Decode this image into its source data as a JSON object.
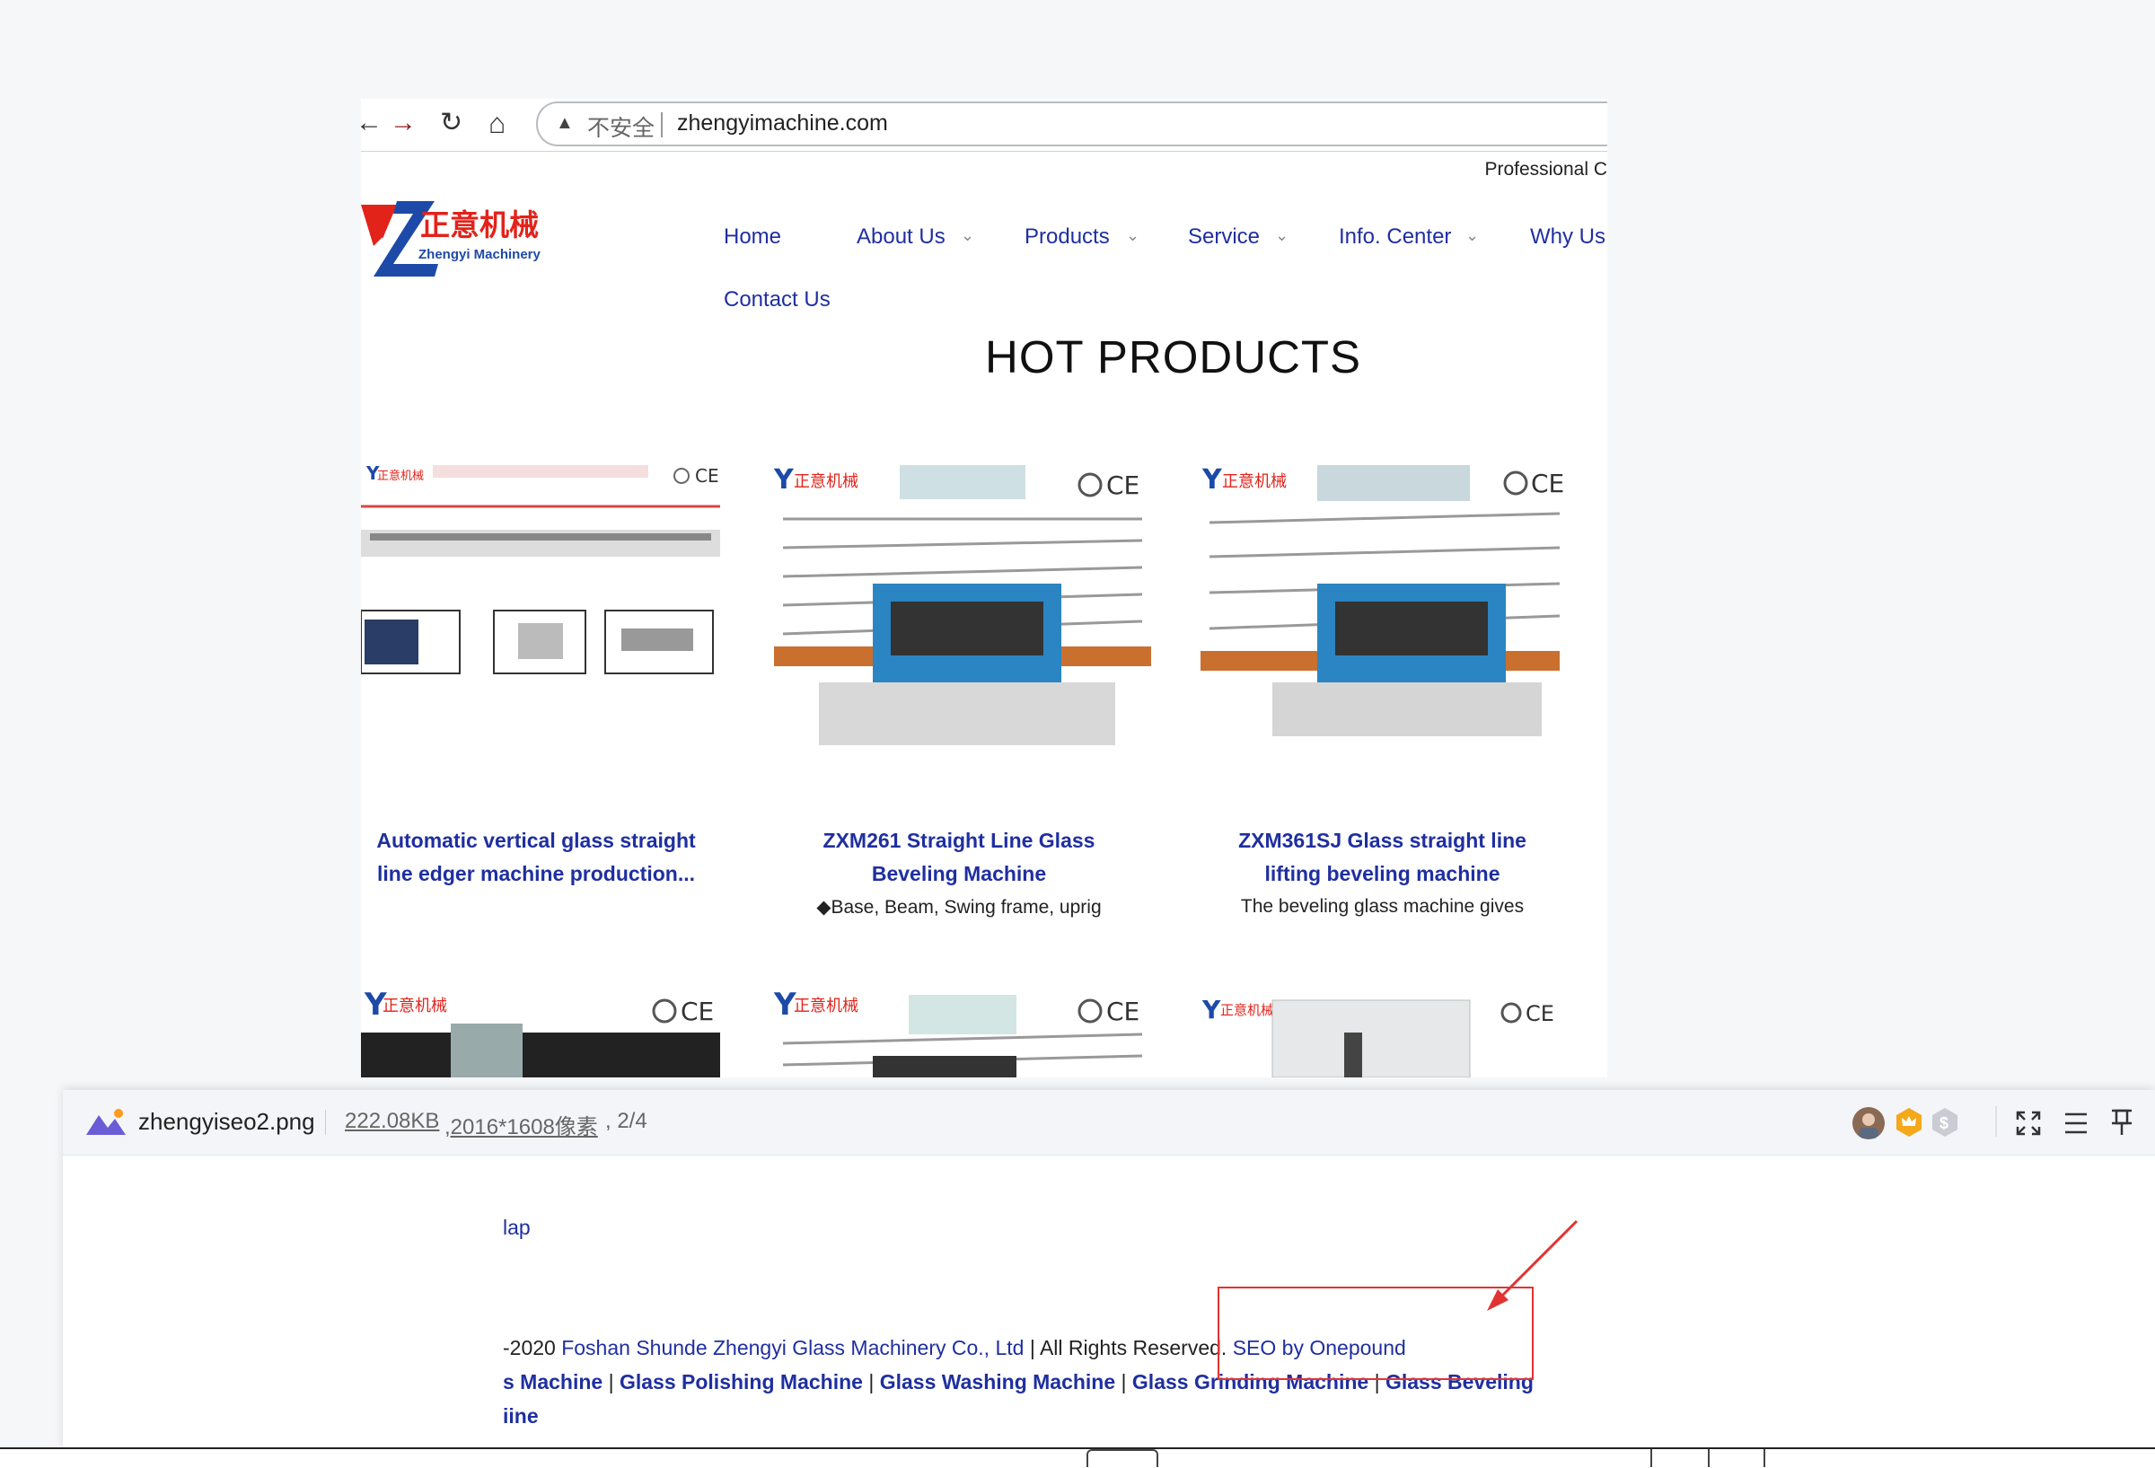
{
  "browser": {
    "back_label": "←",
    "forward_label": "→",
    "reload_label": "↻",
    "home_label": "⌂",
    "security_warning_icon": "warning-triangle-icon",
    "not_secure_label": "不安全",
    "url": "zhengyimachine.com"
  },
  "site": {
    "tagline": "Professional C",
    "logo_text_cn": "正意机械",
    "logo_text_en": "Zhengyi Machinery",
    "nav": [
      {
        "label": "Home",
        "has_dropdown": false
      },
      {
        "label": "About Us",
        "has_dropdown": true
      },
      {
        "label": "Products",
        "has_dropdown": true
      },
      {
        "label": "Service",
        "has_dropdown": true
      },
      {
        "label": "Info. Center",
        "has_dropdown": true
      },
      {
        "label": "Why Us",
        "has_dropdown": false
      },
      {
        "label": "Contact Us",
        "has_dropdown": false
      }
    ],
    "hot_products_title": "HOT PRODUCTS",
    "products": [
      {
        "title_l1": "Automatic vertical glass straight",
        "title_l2": "line edger machine production...",
        "desc": ""
      },
      {
        "title_l1": "ZXM261 Straight Line Glass",
        "title_l2": "Beveling Machine",
        "desc": "◆Base, Beam, Swing frame, uprig"
      },
      {
        "title_l1": "ZXM361SJ Glass straight line",
        "title_l2": "lifting beveling machine",
        "desc": "The beveling glass machine gives"
      }
    ]
  },
  "viewer": {
    "app_icon": "image-viewer-logo-icon",
    "filename": "zhengyiseo2.png",
    "filesize": "222.08KB",
    "dimensions": ",2016*1608像素",
    "page_index": ", 2/4",
    "icons": [
      "avatar-icon",
      "crown-badge-icon",
      "coin-badge-icon",
      "fullscreen-icon",
      "menu-icon",
      "pin-icon"
    ],
    "content": {
      "fragment_top": "lap",
      "footer_prefix": "-2020 ",
      "company_link": "Foshan Shunde Zhengyi Glass Machinery Co., Ltd",
      "rights_text": " | All Rights Reserved. ",
      "seo_link": "SEO by Onepound",
      "keywords": [
        "s Machine",
        "Glass Polishing Machine",
        "Glass Washing Machine",
        "Glass Grinding Machine",
        "Glass Beveling"
      ],
      "keywords_tail": "iine"
    }
  },
  "colors": {
    "link_blue": "#1f2fa0",
    "annotation_red": "#e23333",
    "logo_red": "#e2231a",
    "logo_blue": "#1d4aa8"
  }
}
